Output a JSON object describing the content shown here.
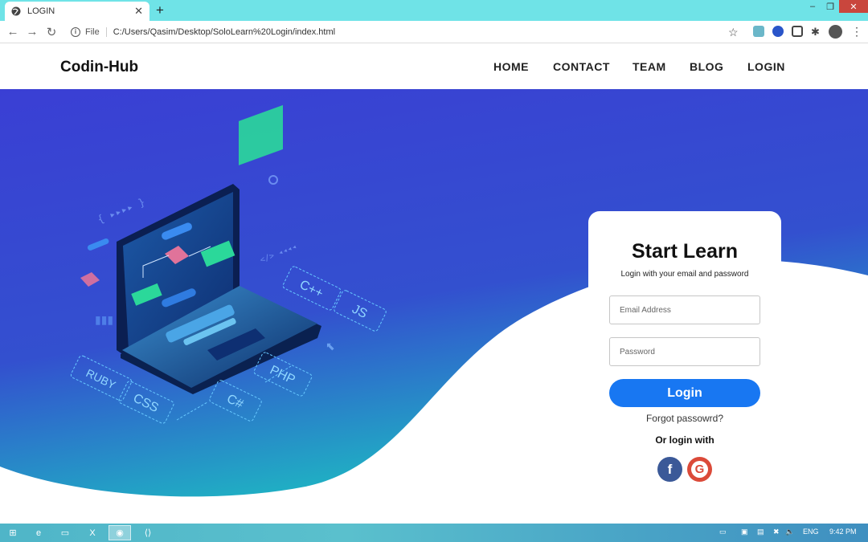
{
  "browser": {
    "tab_title": "LOGIN",
    "new_tab": "+",
    "file_label": "File",
    "url": "C:/Users/Qasim/Desktop/SoloLearn%20Login/index.html"
  },
  "site": {
    "brand": "Codin-Hub",
    "nav": [
      "HOME",
      "CONTACT",
      "TEAM",
      "BLOG",
      "LOGIN"
    ]
  },
  "hero": {
    "code_tags": [
      "C++",
      "JS",
      "PHP",
      "C#",
      "CSS",
      "RUBY"
    ],
    "colors": {
      "gradient_top": "#3a3fd4",
      "gradient_bottom": "#20b4c4",
      "accent_green": "#2bd89a"
    }
  },
  "login": {
    "title": "Start Learn",
    "subtitle": "Login with your email and password",
    "email_placeholder": "Email Address",
    "password_placeholder": "Password",
    "button": "Login",
    "forgot": "Forgot passowrd?",
    "or_login": "Or login with",
    "social": {
      "facebook": "f",
      "google": "G"
    }
  },
  "taskbar": {
    "language": "ENG",
    "time": "9:42 PM"
  }
}
